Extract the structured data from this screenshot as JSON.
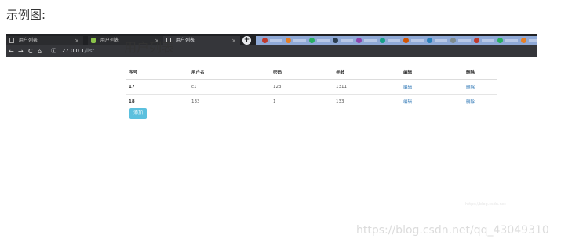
{
  "caption": "示例图:",
  "browser": {
    "tabs": [
      {
        "label": "用户列表",
        "close": "×"
      },
      {
        "label": "用户列表",
        "close": "×"
      },
      {
        "label": "用户列表",
        "close": "×"
      }
    ],
    "new_tab": "+",
    "nav": {
      "back": "←",
      "forward": "→",
      "reload": "C",
      "home": "⌂",
      "info": "ⓘ"
    },
    "url_host": "127.0.0.1",
    "url_path": "/list",
    "bookmark_colors": [
      "#c0392b",
      "#e67e22",
      "#27ae60",
      "#2c3e50",
      "#8e44ad",
      "#16a085",
      "#d35400",
      "#2980b9",
      "#7f8c8d",
      "#c0392b",
      "#27ae60",
      "#e67e22"
    ]
  },
  "page": {
    "title": "用户列表",
    "table": {
      "headers": [
        "序号",
        "用户名",
        "密码",
        "年龄",
        "编辑",
        "删除"
      ],
      "rows": [
        {
          "id": "17",
          "username": "c1",
          "password": "123",
          "age": "1311",
          "edit": "编辑",
          "delete": "删除"
        },
        {
          "id": "18",
          "username": "133",
          "password": "1",
          "age": "133",
          "edit": "编辑",
          "delete": "删除"
        }
      ]
    },
    "add_button": "添加"
  },
  "watermark_small": "https://blog.csdn.net",
  "watermark": "https://blog.csdn.net/qq_43049310"
}
